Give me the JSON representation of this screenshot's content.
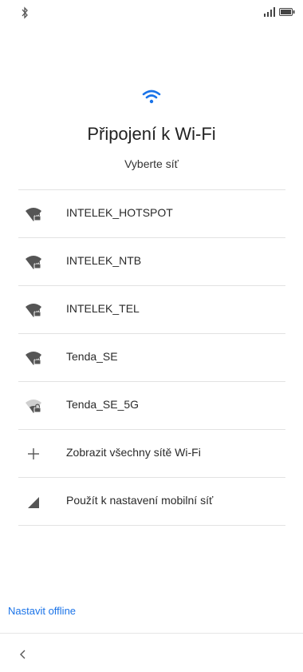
{
  "status_bar": {
    "left_icon": "bluetooth-icon",
    "right_icons": [
      "signal-icon",
      "battery-icon"
    ]
  },
  "header": {
    "icon": "wifi-icon",
    "title": "Připojení k Wi-Fi",
    "subtitle": "Vyberte síť"
  },
  "networks": [
    {
      "label": "INTELEK_HOTSPOT",
      "icon": "wifi-lock-icon"
    },
    {
      "label": "INTELEK_NTB",
      "icon": "wifi-lock-icon"
    },
    {
      "label": "INTELEK_TEL",
      "icon": "wifi-lock-icon"
    },
    {
      "label": "Tenda_SE",
      "icon": "wifi-lock-icon"
    },
    {
      "label": "Tenda_SE_5G",
      "icon": "wifi-lock-weak-icon"
    }
  ],
  "actions": {
    "show_all": {
      "label": "Zobrazit všechny sítě Wi-Fi",
      "icon": "plus-icon"
    },
    "mobile": {
      "label": "Použít k nastavení mobilní síť",
      "icon": "cellular-signal-icon"
    }
  },
  "footer": {
    "offline_label": "Nastavit offline",
    "back_icon": "back-chevron-icon"
  },
  "colors": {
    "accent": "#1a73e8",
    "icon_dark": "#555555",
    "icon_light": "#bdbdbd"
  }
}
